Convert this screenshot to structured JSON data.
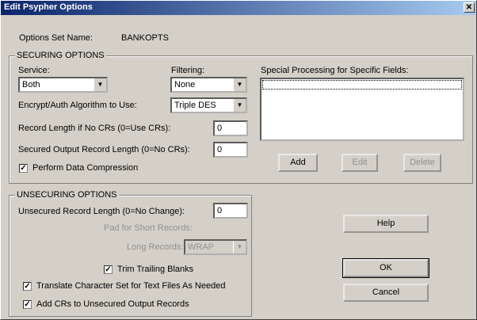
{
  "window": {
    "title": "Edit Psypher Options"
  },
  "options_set": {
    "label": "Options Set Name:",
    "value": "BANKOPTS"
  },
  "securing": {
    "group_title": "SECURING OPTIONS",
    "service_label": "Service:",
    "service_value": "Both",
    "filtering_label": "Filtering:",
    "filtering_value": "None",
    "algorithm_label": "Encrypt/Auth Algorithm to Use:",
    "algorithm_value": "Triple DES",
    "record_length_label": "Record Length if No CRs (0=Use CRs):",
    "record_length_value": "0",
    "secured_output_label": "Secured Output Record Length (0=No CRs):",
    "secured_output_value": "0",
    "compression_label": "Perform Data Compression",
    "special_label": "Special Processing for Specific Fields:",
    "add_label": "Add",
    "edit_label": "Edit",
    "delete_label": "Delete"
  },
  "unsecuring": {
    "group_title": "UNSECURING OPTIONS",
    "record_length_label": "Unsecured Record Length (0=No Change):",
    "record_length_value": "0",
    "pad_label": "Pad for Short Records:",
    "long_records_label": "Long Records:",
    "long_records_value": "WRAP",
    "trim_label": "Trim Trailing Blanks",
    "translate_label": "Translate Character Set for Text Files As Needed",
    "add_crs_label": "Add CRs to Unsecured Output Records"
  },
  "buttons": {
    "help": "Help",
    "ok": "OK",
    "cancel": "Cancel"
  },
  "checkbox_mark": "✓",
  "icons": {
    "dropdown": "chevron-down-icon",
    "close": "close-icon"
  }
}
